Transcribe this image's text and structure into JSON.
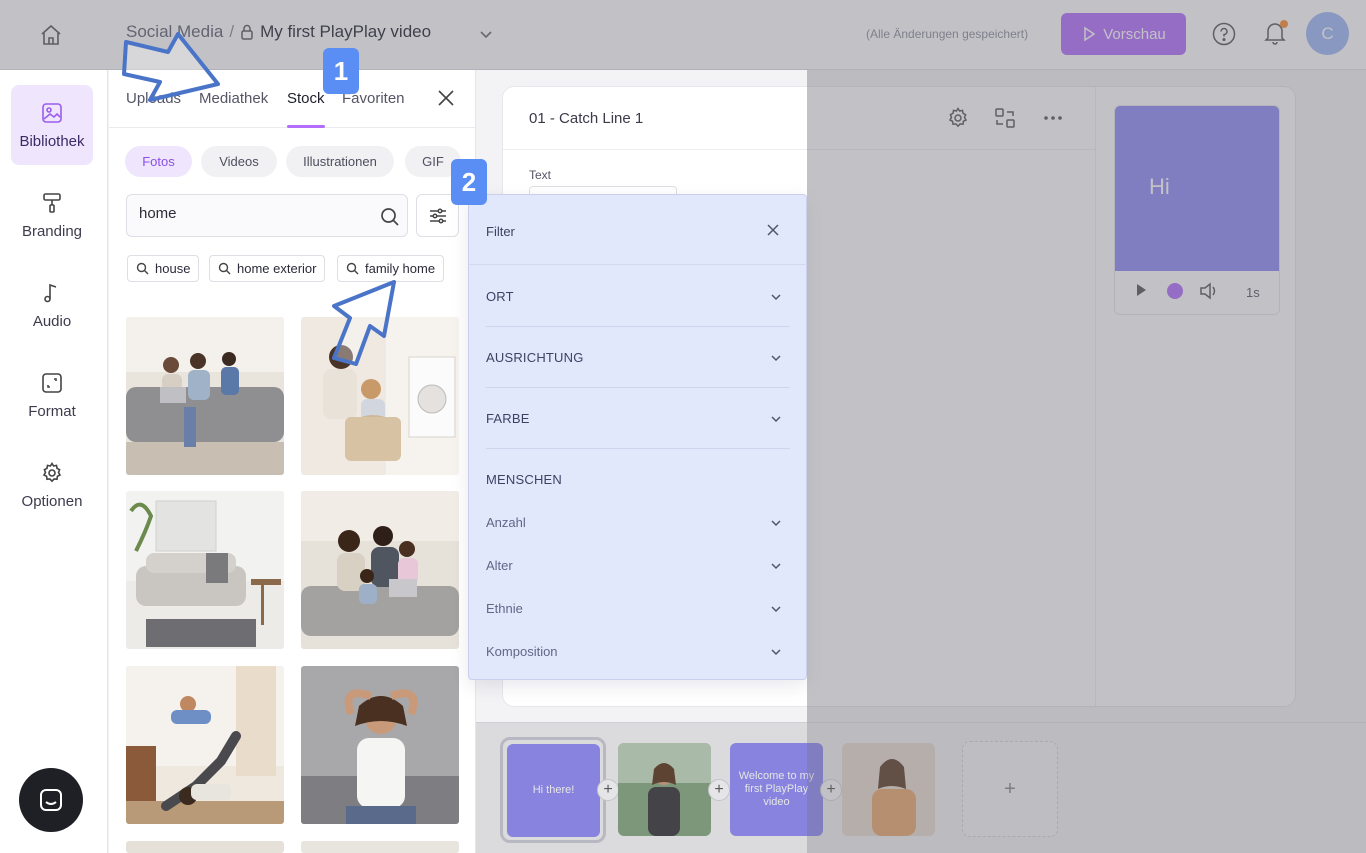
{
  "header": {
    "breadcrumb_parent": "Social Media",
    "breadcrumb_sep": "/",
    "project_title": "My first PlayPlay video",
    "saved_status": "(Alle Änderungen gespeichert)",
    "preview_label": "Vorschau",
    "avatar_initial": "C"
  },
  "rail": {
    "items": [
      {
        "label": "Bibliothek",
        "icon": "image-icon"
      },
      {
        "label": "Branding",
        "icon": "paint-roller-icon"
      },
      {
        "label": "Audio",
        "icon": "music-note-icon"
      },
      {
        "label": "Format",
        "icon": "resize-icon"
      },
      {
        "label": "Optionen",
        "icon": "gear-icon"
      }
    ]
  },
  "library": {
    "tabs": [
      "Uploads",
      "Mediathek",
      "Stock",
      "Favoriten"
    ],
    "active_tab": "Stock",
    "chips": [
      "Fotos",
      "Videos",
      "Illustrationen",
      "GIF"
    ],
    "search_value": "home",
    "suggestions": [
      "house",
      "home exterior",
      "family home"
    ]
  },
  "editor": {
    "scene_title": "01 - Catch Line 1",
    "text_label": "Text",
    "preview_text": "Hi",
    "preview_time": "1s"
  },
  "filter": {
    "title": "Filter",
    "sections": [
      "ORT",
      "AUSRICHTUNG",
      "FARBE"
    ],
    "people_heading": "MENSCHEN",
    "people_items": [
      "Anzahl",
      "Alter",
      "Ethnie",
      "Komposition"
    ]
  },
  "timeline": {
    "scenes": [
      "Hi there!",
      "",
      "Welcome to my first PlayPlay video",
      ""
    ],
    "add_label": "+"
  },
  "tutorial": {
    "step1": "1",
    "step2": "2"
  },
  "colors": {
    "accent": "#b26dfb",
    "tutorial_blue": "#5b8ef5",
    "scene_purple": "#8e88f5"
  }
}
